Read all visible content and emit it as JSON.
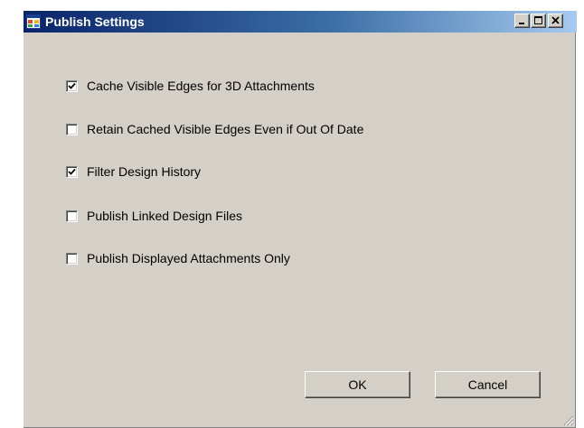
{
  "window": {
    "title": "Publish Settings",
    "icons": {
      "app": "app-window-icon",
      "minimize": "minimize-icon",
      "maximize": "maximize-icon",
      "close": "close-icon",
      "grip": "resize-grip-icon"
    }
  },
  "options": [
    {
      "label": "Cache Visible Edges for 3D Attachments",
      "checked": true
    },
    {
      "label": "Retain Cached Visible Edges Even if Out Of Date",
      "checked": false
    },
    {
      "label": "Filter Design History",
      "checked": true
    },
    {
      "label": "Publish Linked Design Files",
      "checked": false
    },
    {
      "label": "Publish Displayed Attachments Only",
      "checked": false
    }
  ],
  "buttons": {
    "ok": "OK",
    "cancel": "Cancel"
  },
  "colors": {
    "titlebar_start": "#0a246a",
    "titlebar_end": "#a6caf0",
    "dialog_background": "#d4d0c8"
  }
}
